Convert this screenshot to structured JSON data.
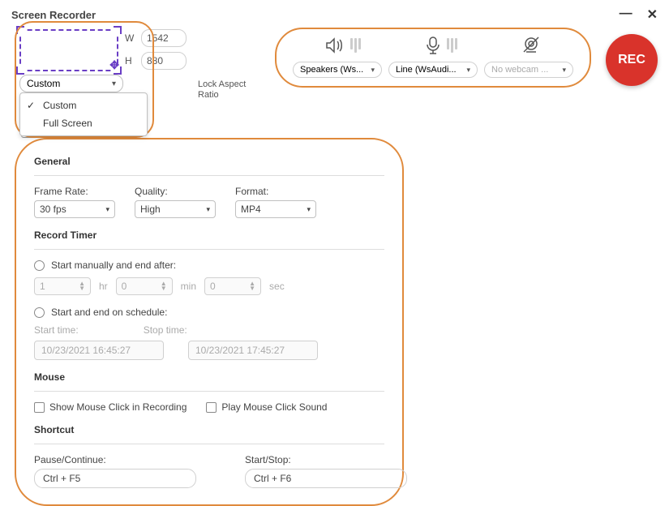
{
  "window": {
    "title": "Screen Recorder"
  },
  "capture": {
    "width_label": "W",
    "width_value": "1542",
    "height_label": "H",
    "height_value": "880",
    "mode_selected": "Custom",
    "mode_options": [
      "Custom",
      "Full Screen"
    ],
    "lock_aspect_label": "Lock Aspect Ratio"
  },
  "audio": {
    "speaker_select": "Speakers (Ws...",
    "mic_select": "Line (WsAudi...",
    "webcam_select": "No webcam ..."
  },
  "rec_label": "REC",
  "general": {
    "heading": "General",
    "frame_rate_label": "Frame Rate:",
    "frame_rate_value": "30 fps",
    "quality_label": "Quality:",
    "quality_value": "High",
    "format_label": "Format:",
    "format_value": "MP4"
  },
  "timer": {
    "heading": "Record Timer",
    "manual_label": "Start manually and end after:",
    "hr_value": "1",
    "hr_unit": "hr",
    "min_value": "0",
    "min_unit": "min",
    "sec_value": "0",
    "sec_unit": "sec",
    "schedule_label": "Start and end on schedule:",
    "start_label": "Start time:",
    "start_value": "10/23/2021 16:45:27",
    "stop_label": "Stop time:",
    "stop_value": "10/23/2021 17:45:27"
  },
  "mouse": {
    "heading": "Mouse",
    "show_click_label": "Show Mouse Click in Recording",
    "play_sound_label": "Play Mouse Click Sound"
  },
  "shortcut": {
    "heading": "Shortcut",
    "pause_label": "Pause/Continue:",
    "pause_value": "Ctrl + F5",
    "start_label": "Start/Stop:",
    "start_value": "Ctrl + F6"
  }
}
